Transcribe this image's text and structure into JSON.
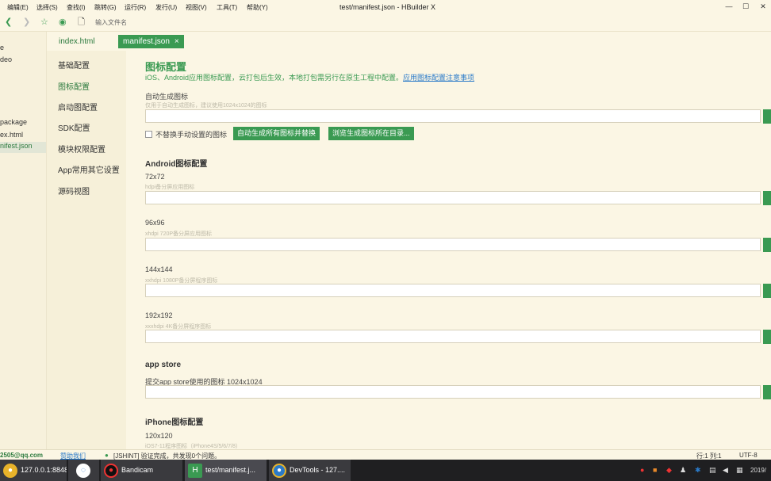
{
  "menubar": {
    "items": [
      "编辑(E)",
      "选择(S)",
      "查找(I)",
      "跳转(G)",
      "运行(R)",
      "发行(U)",
      "视图(V)",
      "工具(T)",
      "帮助(Y)"
    ],
    "title": "test/manifest.json - HBuilder X"
  },
  "window_controls": [
    "—",
    "☐",
    "✕"
  ],
  "toolbar": {
    "icons": [
      "back-icon",
      "forward-icon",
      "star-icon",
      "preview-icon",
      "file-icon"
    ],
    "address_placeholder": "输入文件名"
  },
  "filetree": {
    "items": [
      "e",
      "deo",
      "",
      "",
      "package",
      "ex.html",
      "nifest.json"
    ]
  },
  "tabs": {
    "tab1": "index.html",
    "tab2": "manifest.json",
    "close": "×"
  },
  "setnav": {
    "items": [
      "基础配置",
      "图标配置",
      "启动图配置",
      "SDK配置",
      "模块权限配置",
      "App常用其它设置",
      "源码视图"
    ]
  },
  "content": {
    "title": "图标配置",
    "desc": "iOS、Android应用图标配置，云打包后生效，本地打包需另行在原生工程中配置。",
    "desc_link": "应用图标配置注意事项",
    "auto_label": "自动生成图标",
    "auto_hint": "仅用于自动生成图标，建议使用1024x1024的图标",
    "checkbox_label": "不替换手动设置的图标",
    "btn_generate": "自动生成所有图标并替换",
    "btn_browse": "浏览生成图标所在目录...",
    "android_heading": "Android图标配置",
    "icons": [
      {
        "size": "72x72",
        "hint": "hdpi备分屏应用图标"
      },
      {
        "size": "96x96",
        "hint": "xhdpi 720P备分屏应用图标"
      },
      {
        "size": "144x144",
        "hint": "xxhdpi 1080P备分屏程序图标"
      },
      {
        "size": "192x192",
        "hint": "xxxhdpi 4K备分屏程序图标"
      }
    ],
    "appstore_heading": "app store",
    "appstore_label": "提交app store使用的图标 1024x1024",
    "iphone_heading": "iPhone图标配置",
    "iphone_size": "120x120",
    "iphone_hint": "iOS7-11程序图标（iPhone4S/5/6/7/8）"
  },
  "statusbar": {
    "email": "2505@qq.com",
    "help": "赞助我们",
    "message": "[JSHINT] 验证完成，共发现0个问题。",
    "position": "行:1  列:1",
    "encoding": "UTF-8"
  },
  "taskbar": {
    "items": [
      "127.0.0.1:8848...",
      "",
      "Bandicam",
      "test/manifest.j...",
      "DevTools - 127...."
    ],
    "tray_date": "2019/"
  },
  "colors": {
    "accent": "#3a9a52",
    "background": "#fbf6e4",
    "link": "#2a7ac9"
  }
}
